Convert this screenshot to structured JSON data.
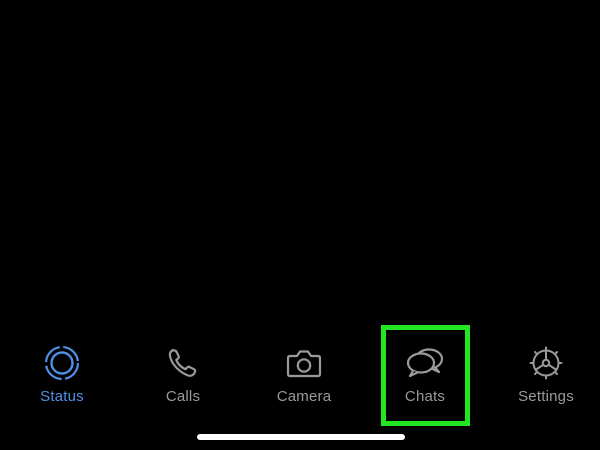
{
  "tab_bar": {
    "active_tab": "Status",
    "tabs": [
      {
        "label": "Status",
        "icon": "status-ring-icon"
      },
      {
        "label": "Calls",
        "icon": "phone-icon"
      },
      {
        "label": "Camera",
        "icon": "camera-icon"
      },
      {
        "label": "Chats",
        "icon": "chat-bubbles-icon"
      },
      {
        "label": "Settings",
        "icon": "gear-icon"
      }
    ]
  },
  "annotation": {
    "highlighted_tab": "Chats",
    "highlight_color": "#22e622"
  },
  "colors": {
    "background": "#000000",
    "active_tab_color": "#4f8fe6",
    "inactive_tab_color": "#9a9a9a",
    "home_indicator": "#ffffff"
  }
}
